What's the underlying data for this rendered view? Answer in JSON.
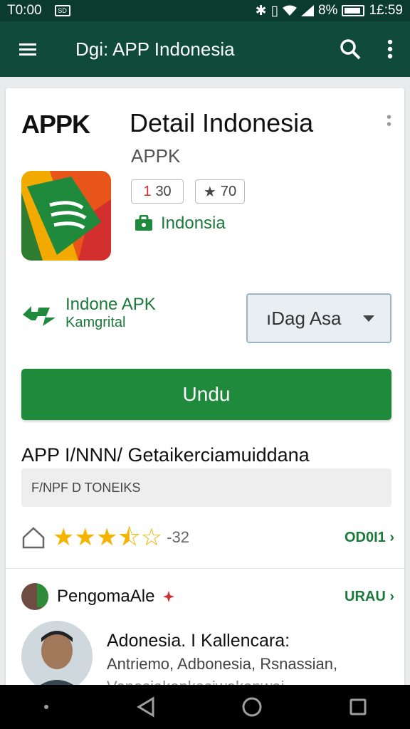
{
  "status_bar": {
    "time": "T0:00",
    "notification_box": "SD",
    "battery_percent": "8%",
    "clock_right": "1£:59"
  },
  "app_bar": {
    "title": "Dgi: APP Indonesia"
  },
  "app": {
    "brand_logo": "APPK",
    "title": "Detail Indonesia",
    "developer": "APPK",
    "downloads_chip_number": "1",
    "downloads_chip_text": "30",
    "rating_chip_text": "70",
    "country": "Indonsia"
  },
  "developer_row": {
    "name": "Indone APK",
    "subtitle": "Kamgrital"
  },
  "dropdown": {
    "selected": "ıDag Asa"
  },
  "install_button": {
    "label": "Undu"
  },
  "description": {
    "heading": "APP I/NNN/ Getaikerciamuiddana",
    "box_text": "F/NPF D TONEIKS"
  },
  "rating": {
    "stars_filled": 3.5,
    "stars_total": 5,
    "count": "-32",
    "more_link": "OD0I1 ›"
  },
  "reviews": {
    "label": "PengomaAle",
    "more_link": "URAU ›",
    "first": {
      "title": "Adonesia. I Kallencara:",
      "text": "Antriemo, Adbonesia, Rsnassian,",
      "text2": "Vonesiakonkasiwakonwai"
    }
  },
  "colors": {
    "app_bar": "#0f4a3b",
    "accent_green": "#1f8a3b",
    "star": "#f5b400"
  }
}
